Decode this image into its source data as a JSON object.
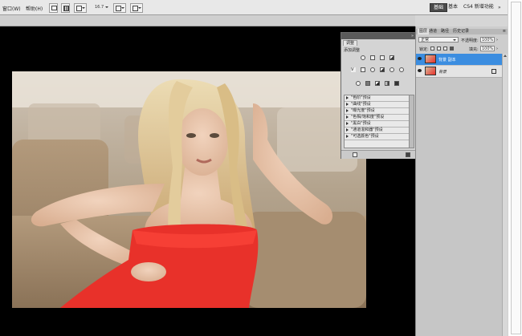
{
  "menubar": {
    "window_menu": "窗口(W)",
    "help_menu": "帮助(H)",
    "zoom_value": "16.7",
    "workspaces": [
      "基本",
      "CS4 新增功能"
    ],
    "active_workspace": "基本",
    "active_workspace_label": "基础"
  },
  "adjustments": {
    "tab": "调整",
    "title": "添加调整",
    "presets": [
      "\"色阶\"预设",
      "\"曲线\"预设",
      "\"曝光度\"预设",
      "\"色相/饱和度\"预设",
      "\"黑白\"预设",
      "\"通道混和器\"预设",
      "\"可选颜色\"预设"
    ]
  },
  "layers_panel": {
    "tabs": [
      "图层",
      "通道",
      "路径",
      "历史记录"
    ],
    "blend_mode": "正常",
    "opacity_label": "不透明度:",
    "opacity_value": "100%",
    "lock_label": "锁定:",
    "fill_label": "填充:",
    "fill_value": "100%",
    "layers": [
      {
        "name": "背景 副本",
        "selected": true
      },
      {
        "name": "背景",
        "selected": false,
        "locked": true
      }
    ]
  },
  "colors": {
    "selection": "#3b8de0",
    "canvas_bg": "#000000",
    "dress": "#e8312a"
  }
}
